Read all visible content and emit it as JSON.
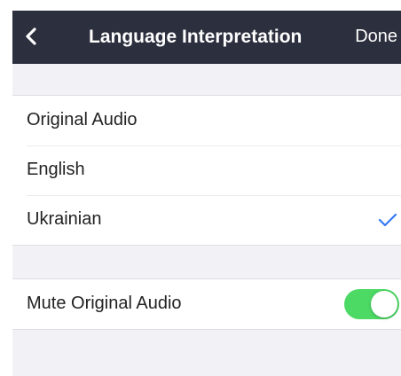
{
  "navbar": {
    "back_icon": "chevron-left-icon",
    "title": "Language Interpretation",
    "done_label": "Done",
    "background_color": "#2c2f3e"
  },
  "languages": {
    "items": [
      {
        "label": "Original Audio",
        "selected": false
      },
      {
        "label": "English",
        "selected": false
      },
      {
        "label": "Ukrainian",
        "selected": true
      }
    ],
    "check_icon": "checkmark-icon",
    "check_color": "#3478f6"
  },
  "mute": {
    "label": "Mute Original Audio",
    "toggle_on": true,
    "toggle_color": "#4cd964"
  }
}
